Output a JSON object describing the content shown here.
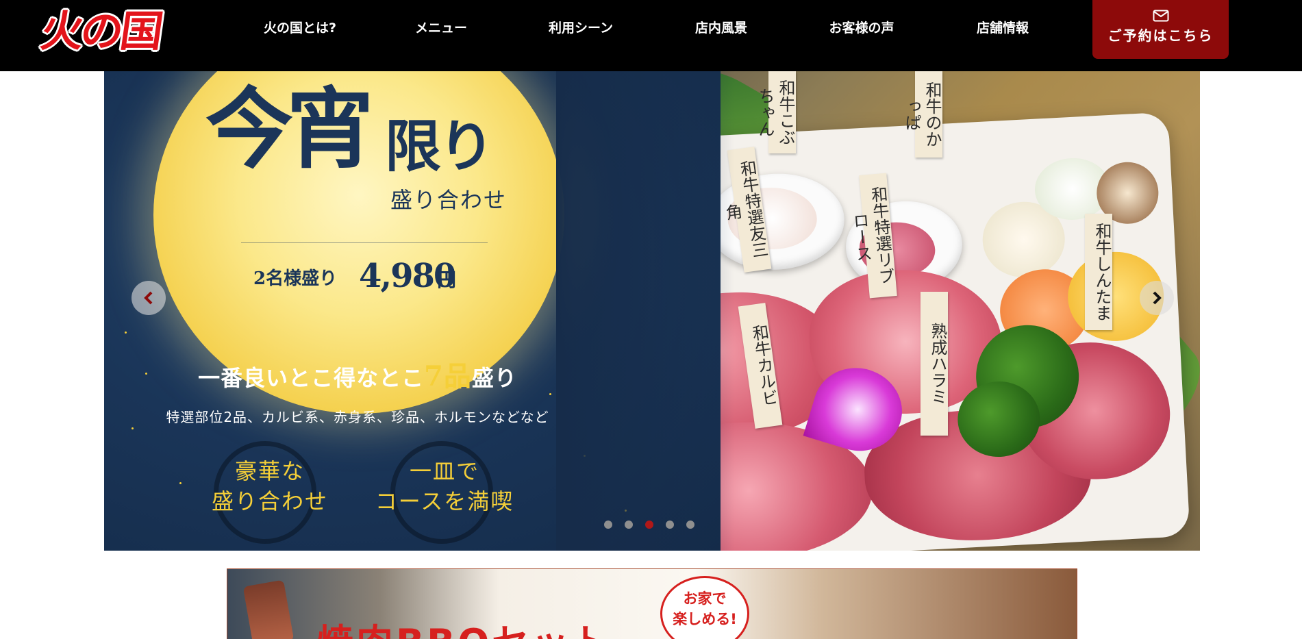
{
  "header": {
    "logo_text": "火の国",
    "nav": [
      {
        "label": "火の国とは?"
      },
      {
        "label": "メニュー"
      },
      {
        "label": "利用シーン"
      },
      {
        "label": "店内風景"
      },
      {
        "label": "お客様の声"
      },
      {
        "label": "店舗情報"
      }
    ],
    "reserve_label": "ご予約はこちら",
    "reserve_icon": "mail-icon"
  },
  "hero": {
    "title_part1": "今宵",
    "title_part2": "限り",
    "subtitle": "盛り合わせ",
    "price_label": "2名様盛り",
    "price_value": "4,980",
    "price_unit": "円",
    "tagline_before": "一番良いとこ得なとこ",
    "tagline_highlight": "7品",
    "tagline_after": "盛り",
    "description": "特選部位2品、カルビ系、赤身系、珍品、ホルモンなどなど",
    "badge_left": "豪華な\n盛り合わせ",
    "badge_right": "一皿で\nコースを満喫",
    "tags": [
      "和牛こぶちゃん",
      "和牛のかっぱ",
      "和牛特選友三角",
      "和牛特選リブロース",
      "和牛カルビ",
      "熟成ハラミ",
      "和牛しんたま"
    ],
    "prev_icon": "chevron-left-icon",
    "next_icon": "chevron-right-icon",
    "slide_count": 5,
    "active_slide": 3
  },
  "banner": {
    "title": "焼肉BBQセット",
    "bubble": "お家で\n楽しめる!"
  },
  "colors": {
    "header_bg": "#000000",
    "reserve_bg": "#8d0a0a",
    "logo_red": "#e3141b",
    "accent_gold": "#f5cf38",
    "navy": "#1b3559",
    "dot_active": "#b01818"
  }
}
